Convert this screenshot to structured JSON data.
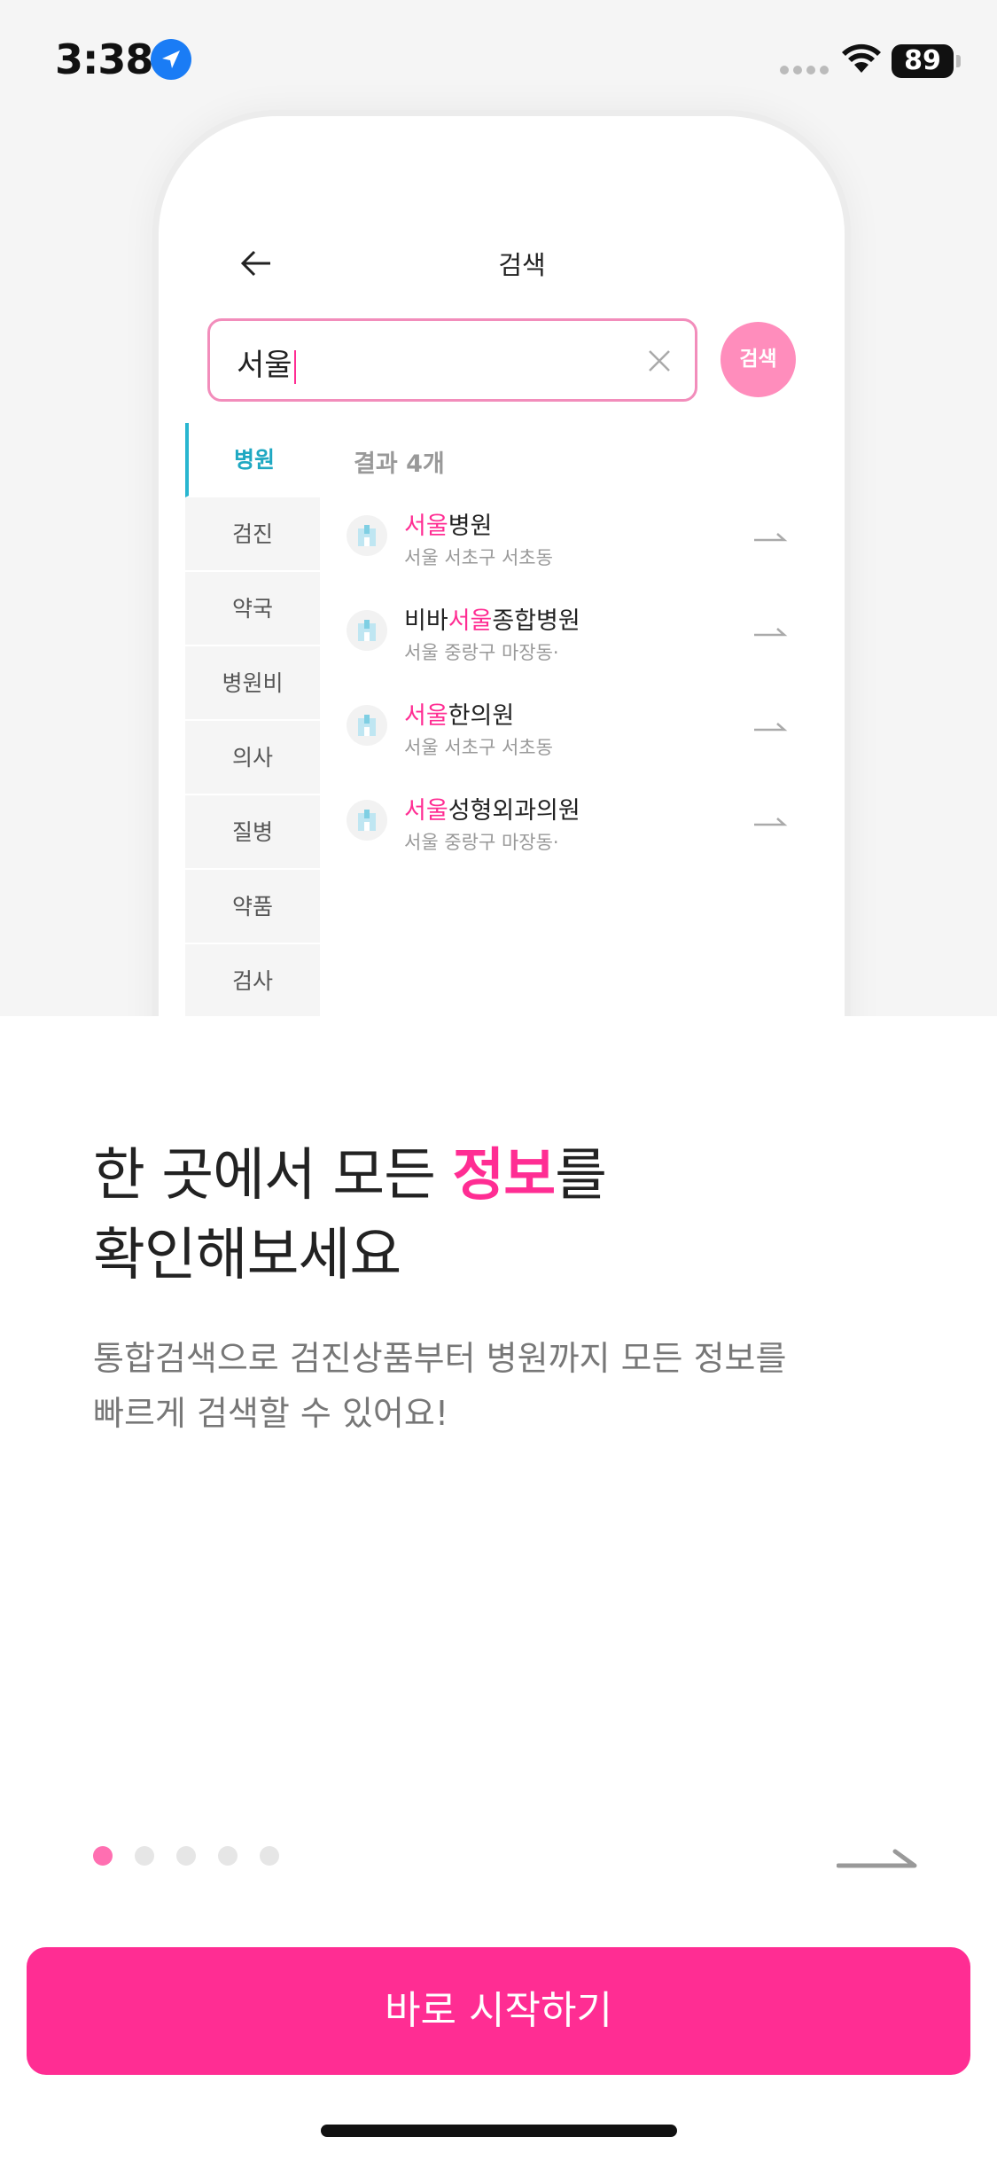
{
  "status_bar": {
    "time": "3:38",
    "battery": "89",
    "location_icon": "location-arrow-icon",
    "wifi_icon": "wifi-icon"
  },
  "mockup": {
    "title": "검색",
    "search_query": "서울",
    "search_button": "검색",
    "categories": [
      "병원",
      "검진",
      "약국",
      "병원비",
      "의사",
      "질병",
      "약품",
      "검사"
    ],
    "active_category": "병원",
    "result_count": "결과 4개",
    "results": [
      {
        "pre": "",
        "hl": "서울",
        "post": "병원",
        "address": "서울 서초구 서초동"
      },
      {
        "pre": "비바",
        "hl": "서울",
        "post": "종합병원",
        "address": "서울 중랑구 마장동·"
      },
      {
        "pre": "",
        "hl": "서울",
        "post": "한의원",
        "address": "서울 서초구 서초동"
      },
      {
        "pre": "",
        "hl": "서울",
        "post": "성형외과의원",
        "address": "서울 중랑구 마장동·"
      }
    ]
  },
  "onboarding": {
    "headline_part1": "한 곳에서 모든 ",
    "headline_highlight": "정보",
    "headline_part2": "를",
    "headline_line2": "확인해보세요",
    "subtext_line1": "통합검색으로 검진상품부터 병원까지 모든 정보를",
    "subtext_line2": "빠르게 검색할 수 있어요!",
    "page_count": 5,
    "current_page": 1,
    "cta_label": "바로 시작하기"
  },
  "colors": {
    "accent": "#ff2d93",
    "accent_light": "#ff8dbc",
    "category_active": "#1fa8c2"
  }
}
